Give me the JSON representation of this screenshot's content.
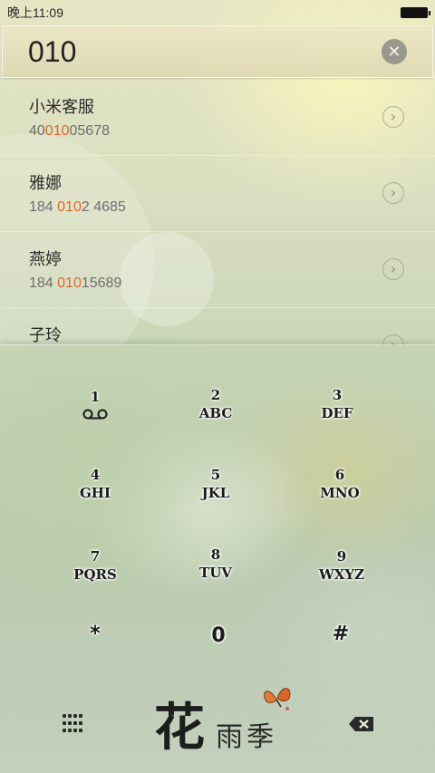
{
  "status": {
    "time": "晚上11:09"
  },
  "search": {
    "value": "010",
    "clear_label": "✕"
  },
  "results": [
    {
      "name": "小米客服",
      "number_pre": "40",
      "number_match": "010",
      "number_post": "05678"
    },
    {
      "name": "雅娜",
      "number_pre": "184 ",
      "number_match": "010",
      "number_post": "2 4685"
    },
    {
      "name": "燕婷",
      "number_pre": "184 ",
      "number_match": "010",
      "number_post": "15689"
    },
    {
      "name": "子玲",
      "number_pre": "",
      "number_match": "",
      "number_post": ""
    }
  ],
  "keypad": {
    "keys": [
      {
        "digit": "1",
        "letters": ""
      },
      {
        "digit": "2",
        "letters": "ABC"
      },
      {
        "digit": "3",
        "letters": "DEF"
      },
      {
        "digit": "4",
        "letters": "GHI"
      },
      {
        "digit": "5",
        "letters": "JKL"
      },
      {
        "digit": "6",
        "letters": "MNO"
      },
      {
        "digit": "7",
        "letters": "PQRS"
      },
      {
        "digit": "8",
        "letters": "TUV"
      },
      {
        "digit": "9",
        "letters": "WXYZ"
      },
      {
        "digit": "*",
        "letters": ""
      },
      {
        "digit": "0",
        "letters": ""
      },
      {
        "digit": "#",
        "letters": ""
      }
    ]
  },
  "logo": {
    "big": "花",
    "small": "雨季"
  },
  "colors": {
    "highlight": "#e2662a",
    "text": "#2b2b2b"
  },
  "icons": {
    "voicemail": "voicemail-icon",
    "clear": "clear-icon",
    "chevron": "chevron-right-icon",
    "keypad_toggle": "keypad-grid-icon",
    "backspace": "backspace-icon",
    "butterfly": "butterfly-icon"
  }
}
